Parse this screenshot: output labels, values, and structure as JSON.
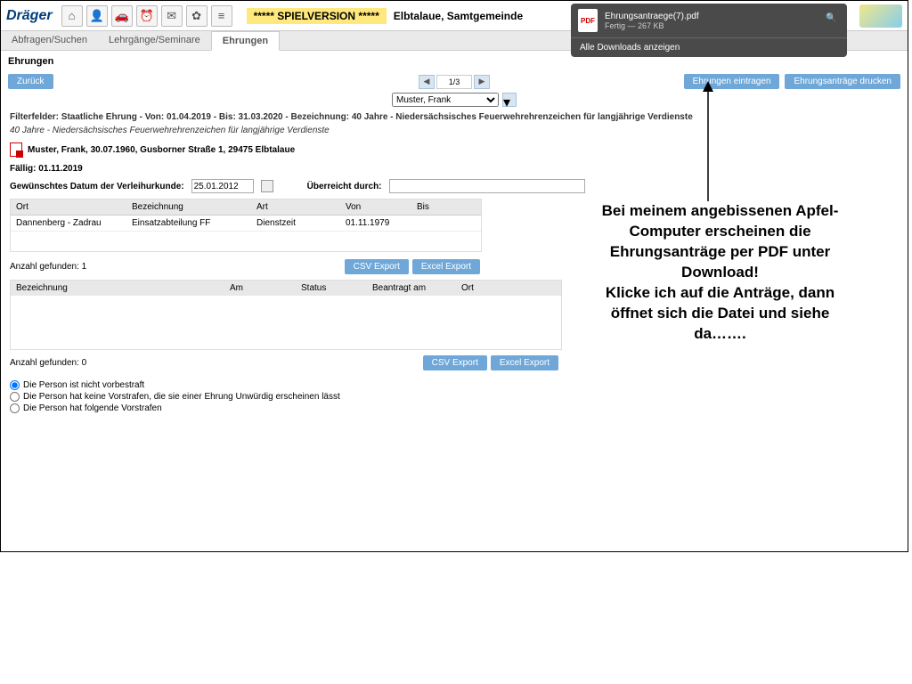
{
  "logo": "Dräger",
  "spielversion": "***** SPIELVERSION *****",
  "location": "Elbtalaue, Samtgemeinde",
  "download": {
    "filename": "Ehrungsantraege(7).pdf",
    "status": "Fertig — 267 KB",
    "footer": "Alle Downloads anzeigen"
  },
  "tabs": {
    "t1": "Abfragen/Suchen",
    "t2": "Lehrgänge/Seminare",
    "t3": "Ehrungen"
  },
  "section": "Ehrungen",
  "back": "Zurück",
  "pager": "1/3",
  "personSelect": "Muster, Frank",
  "btn_enter": "Ehrungen eintragen",
  "btn_print": "Ehrungsanträge drucken",
  "filter1": "Filterfelder: Staatliche Ehrung - Von: 01.04.2019 - Bis: 31.03.2020 - Bezeichnung: 40 Jahre - Niedersächsisches Feuerwehrehrenzeichen für langjährige Verdienste",
  "filter2": "40 Jahre - Niedersächsisches Feuerwehrehrenzeichen für langjährige Verdienste",
  "person": "Muster, Frank, 30.07.1960, Gusborner Straße 1, 29475 Elbtalaue",
  "due": "Fällig: 01.11.2019",
  "lbl_date": "Gewünschtes Datum der Verleihurkunde:",
  "date_val": "25.01.2012",
  "lbl_uber": "Überreicht durch:",
  "tbl": {
    "h1": "Ort",
    "h2": "Bezeichnung",
    "h3": "Art",
    "h4": "Von",
    "h5": "Bis",
    "r1c1": "Dannenberg - Zadrau",
    "r1c2": "Einsatzabteilung FF",
    "r1c3": "Dienstzeit",
    "r1c4": "01.11.1979",
    "r1c5": ""
  },
  "count1": "Anzahl gefunden: 1",
  "csv": "CSV Export",
  "excel": "Excel Export",
  "tbl2": {
    "h1": "Bezeichnung",
    "h2": "Am",
    "h3": "Status",
    "h4": "Beantragt am",
    "h5": "Ort"
  },
  "count2": "Anzahl gefunden: 0",
  "radio1": "Die Person ist nicht vorbestraft",
  "radio2": "Die Person hat keine Vorstrafen, die sie einer Ehrung Unwürdig erscheinen lässt",
  "radio3": "Die Person hat folgende Vorstrafen",
  "annotation": "Bei meinem angebissenen Apfel-Computer erscheinen die Ehrungsanträge per PDF unter Download!\nKlicke ich auf die Anträge, dann öffnet sich die Datei und siehe da……."
}
